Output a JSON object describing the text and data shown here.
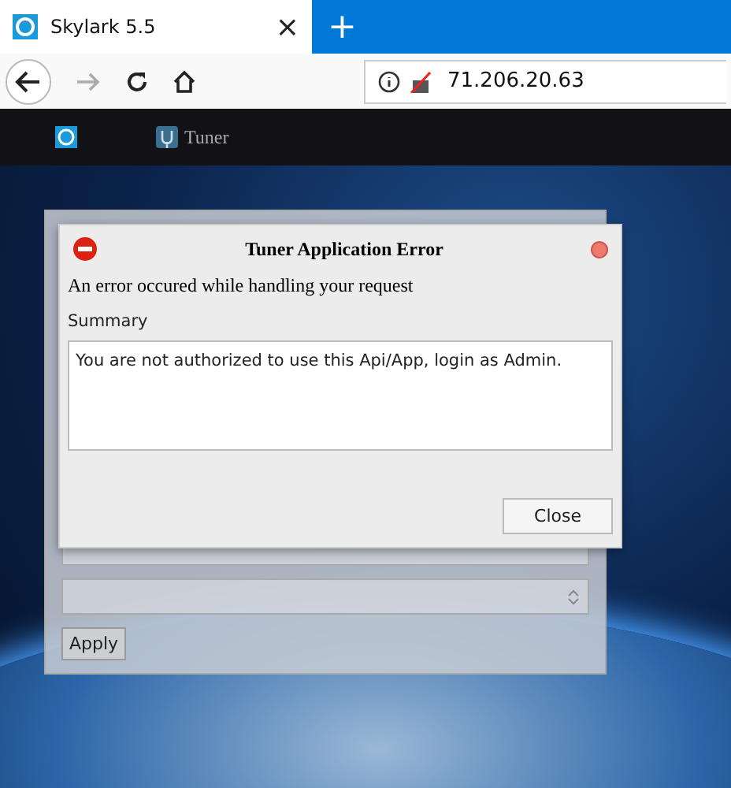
{
  "browser": {
    "tab_title": "Skylark 5.5",
    "tab_close": "×",
    "new_tab": "+",
    "address": "71.206.20.63"
  },
  "app_bar": {
    "items": [
      {
        "label": "Tuner"
      }
    ]
  },
  "background_window": {
    "apply_button": "Apply"
  },
  "dialog": {
    "title": "Tuner Application Error",
    "message": "An error occured while handling your request",
    "summary_label": "Summary",
    "summary": "You are not authorized to use this Api/App, login as Admin.",
    "close_button": "Close"
  }
}
